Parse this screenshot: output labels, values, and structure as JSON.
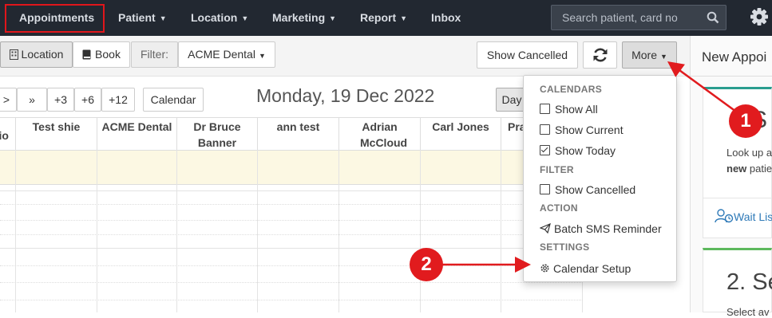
{
  "nav": {
    "items": [
      {
        "label": "Appointments",
        "caret": false
      },
      {
        "label": "Patient",
        "caret": true
      },
      {
        "label": "Location",
        "caret": true
      },
      {
        "label": "Marketing",
        "caret": true
      },
      {
        "label": "Report",
        "caret": true
      },
      {
        "label": "Inbox",
        "caret": false
      }
    ],
    "search_placeholder": "Search patient, card no"
  },
  "toolbar": {
    "location": "Location",
    "book": "Book",
    "filter_label": "Filter:",
    "filter_value": "ACME Dental",
    "show_cancelled": "Show Cancelled",
    "more": "More"
  },
  "datenav": {
    "buttons": [
      ">",
      "»",
      "+3",
      "+6",
      "+12"
    ],
    "calendar": "Calendar",
    "date_title": "Monday, 19 Dec 2022",
    "day": "Day"
  },
  "grid": {
    "columns": [
      "io",
      "Test shie",
      "ACME Dental",
      "Dr Bruce Banner",
      "ann test",
      "Adrian McCloud",
      "Carl Jones",
      "Pra"
    ]
  },
  "menu": {
    "calendars_header": "CALENDARS",
    "show_all": "Show All",
    "show_current": "Show Current",
    "show_today": "Show Today",
    "filter_header": "FILTER",
    "show_cancelled": "Show Cancelled",
    "action_header": "ACTION",
    "batch_sms": "Batch SMS Reminder",
    "settings_header": "SETTINGS",
    "calendar_setup": "Calendar Setup",
    "checks": {
      "show_all": false,
      "show_current": false,
      "show_today": true,
      "show_cancelled": false
    }
  },
  "right_panel": {
    "title": "New Appoi",
    "step1_number": "S",
    "lookup_text": "Look up a",
    "new_text": "new",
    "patie_text": "patie",
    "wait_list": "Wait Lis",
    "step2": "2. Se",
    "select_text": "Select av"
  },
  "markers": [
    "1",
    "2"
  ],
  "colors": {
    "accent_red": "#e11b1e",
    "navbar": "#222831",
    "allday_row": "#fcf8e3",
    "panel_teal": "#2a9d8f",
    "panel_green": "#5cb85c"
  }
}
